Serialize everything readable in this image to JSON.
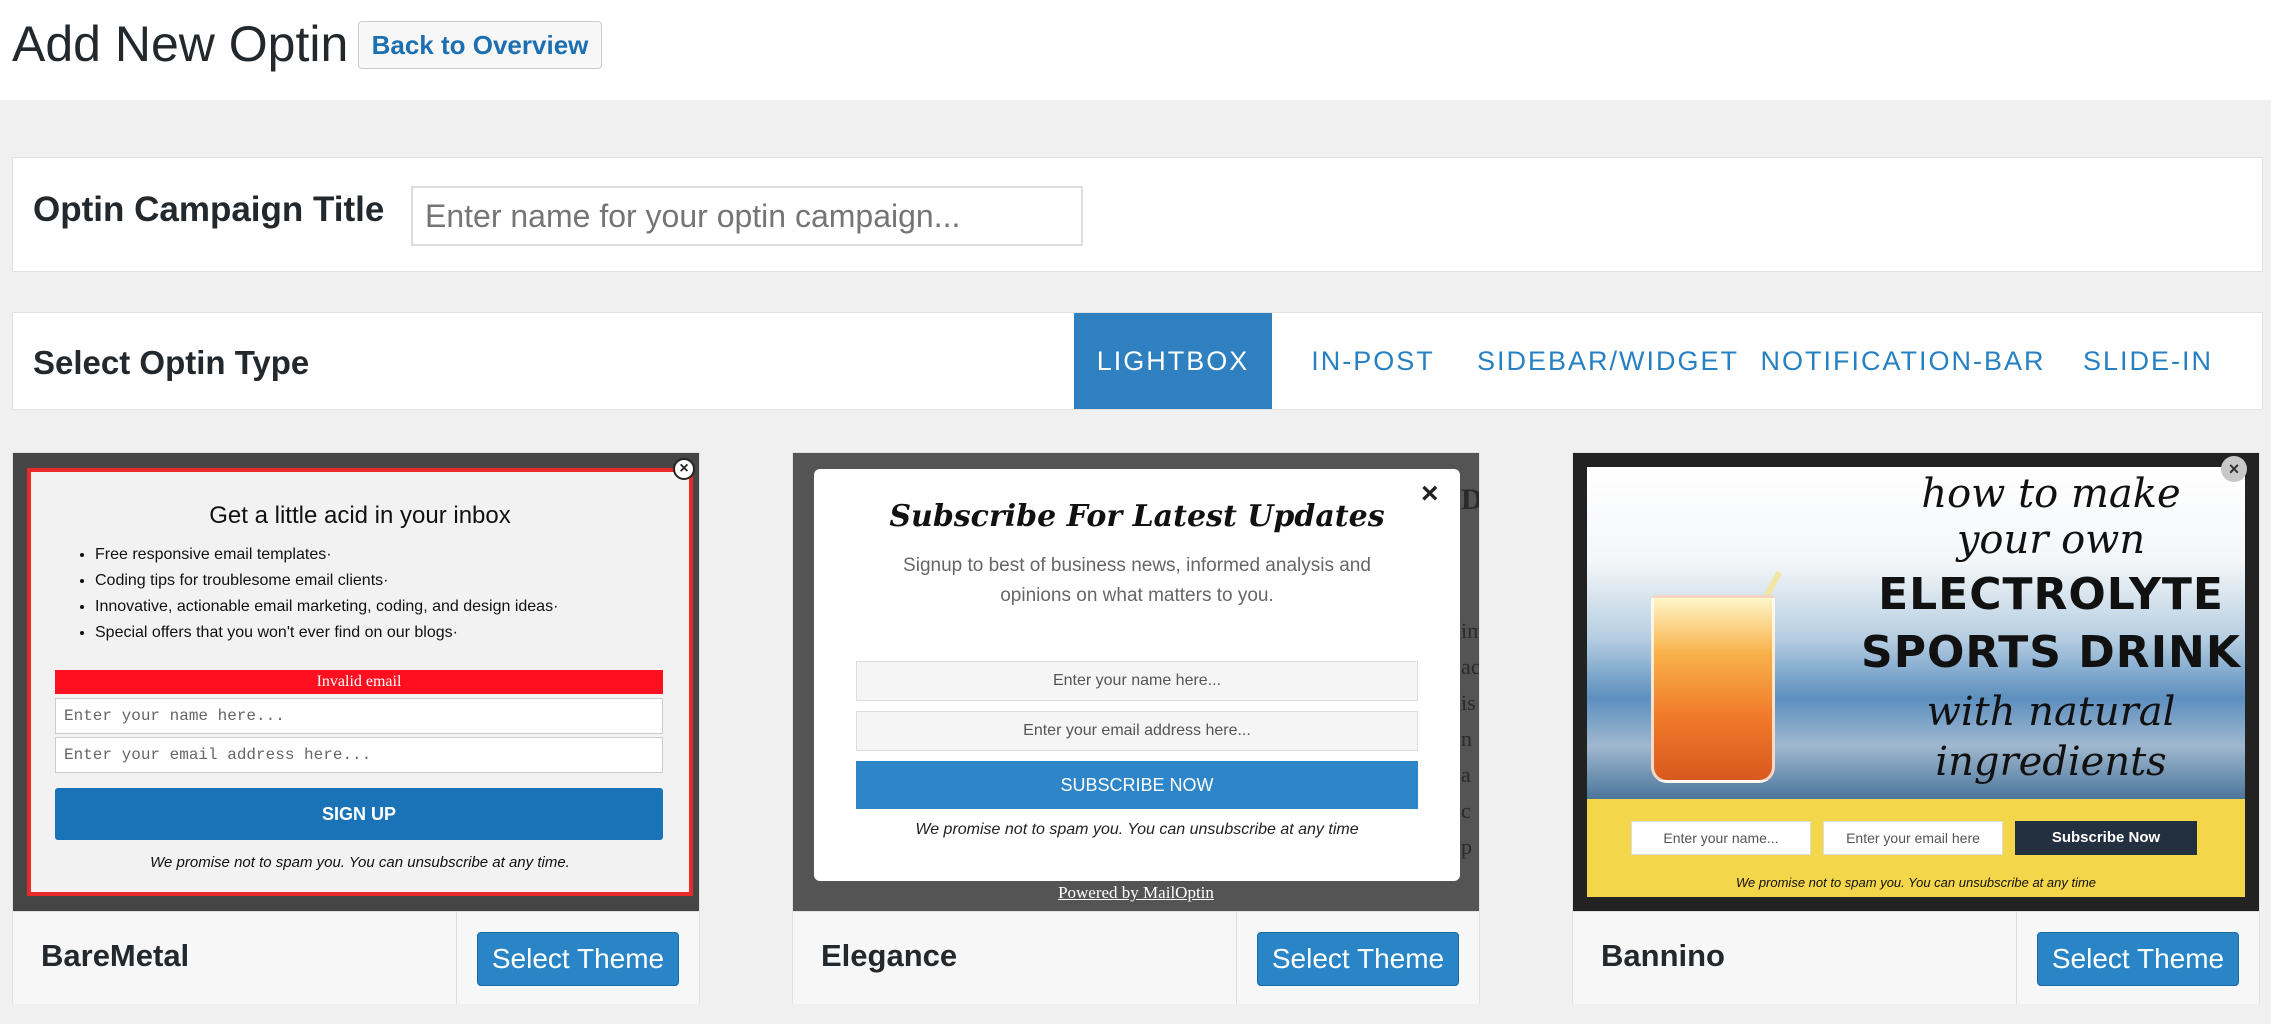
{
  "header": {
    "title": "Add New Optin",
    "back_button": "Back to Overview"
  },
  "campaign": {
    "label": "Optin Campaign Title",
    "placeholder": "Enter name for your optin campaign..."
  },
  "optin_type": {
    "label": "Select Optin Type",
    "tabs": [
      "LIGHTBOX",
      "IN-POST",
      "SIDEBAR/WIDGET",
      "NOTIFICATION-BAR",
      "SLIDE-IN"
    ],
    "active": "LIGHTBOX"
  },
  "themes": [
    {
      "name": "BareMetal",
      "button": "Select Theme",
      "preview": {
        "heading": "Get a little acid in your inbox",
        "bullets": [
          "Free responsive email templates·",
          "Coding tips for troublesome email clients·",
          "Innovative, actionable email marketing, coding, and design ideas·",
          "Special offers that you won't ever find on our blogs·"
        ],
        "error": "Invalid email",
        "name_placeholder": "Enter your name here...",
        "email_placeholder": "Enter your email address here...",
        "cta": "SIGN UP",
        "note": "We promise not to spam you. You can unsubscribe at any time.",
        "close": "×"
      }
    },
    {
      "name": "Elegance",
      "button": "Select Theme",
      "preview": {
        "heading": "Subscribe For Latest Updates",
        "description": "Signup to best of business news, informed analysis and opinions on what matters to you.",
        "name_placeholder": "Enter your name here...",
        "email_placeholder": "Enter your email address here...",
        "cta": "SUBSCRIBE NOW",
        "note": "We promise not to spam you. You can unsubscribe at any time",
        "powered_by": "Powered by MailOptin",
        "close": "×"
      }
    },
    {
      "name": "Bannino",
      "button": "Select Theme",
      "preview": {
        "line1": "how to make",
        "line2": "your own",
        "line3": "ELECTROLYTE",
        "line4": "SPORTS DRINK",
        "line5": "with natural",
        "line6": "ingredients",
        "name_placeholder": "Enter your name...",
        "email_placeholder": "Enter your email here",
        "cta": "Subscribe Now",
        "note": "We promise not to spam you. You can unsubscribe at any time",
        "close": "×"
      }
    }
  ],
  "colors": {
    "accent": "#2f80c0",
    "error_red": "#ff0f1f",
    "banner_yellow": "#f4d64b"
  }
}
